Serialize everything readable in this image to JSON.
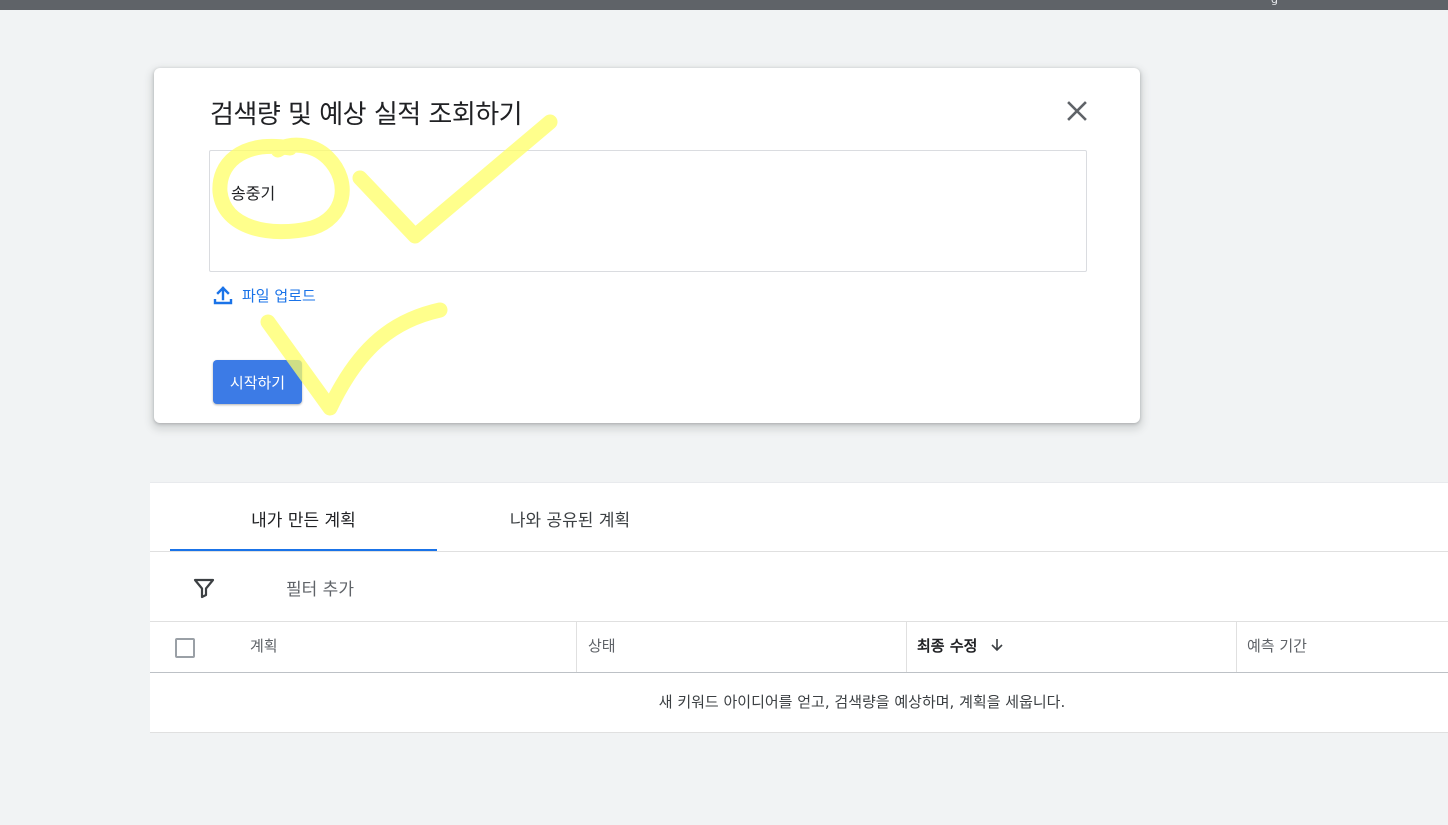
{
  "topbar": {
    "corner_text": "g"
  },
  "dialog": {
    "title": "검색량 및 예상 실적 조회하기",
    "keyword_value": "송중기",
    "upload_label": "파일 업로드",
    "start_label": "시작하기",
    "close_icon": "close-icon",
    "upload_icon": "upload-icon"
  },
  "plans": {
    "tabs": [
      {
        "label": "내가 만든 계획",
        "active": true
      },
      {
        "label": "나와 공유된 계획",
        "active": false
      }
    ],
    "filter": {
      "label": "필터 추가",
      "icon": "filter-icon"
    },
    "table": {
      "headers": {
        "plan": "계획",
        "status": "상태",
        "modified": "최종 수정",
        "period": "예측 기간"
      },
      "sort_icon": "arrow-down-icon",
      "empty_message": "새 키워드 아이디어를 얻고, 검색량을 예상하며, 계획을 세웁니다."
    }
  },
  "colors": {
    "accent": "#1a73e8",
    "button": "#3c7be6",
    "highlighter": "#ffff66"
  }
}
